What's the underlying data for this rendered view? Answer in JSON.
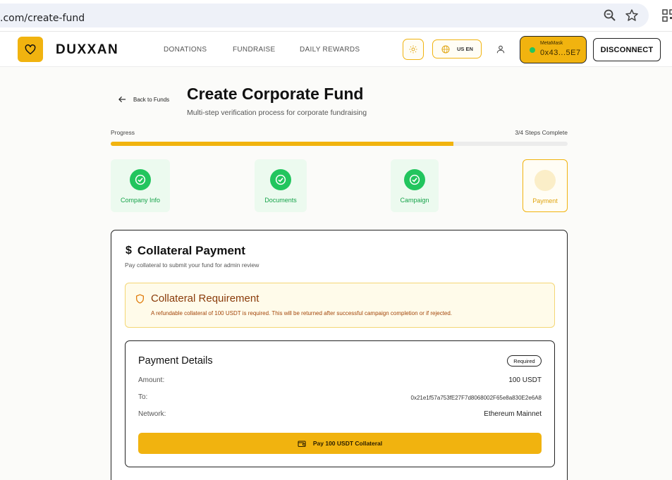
{
  "browser": {
    "url": ".com/create-fund"
  },
  "header": {
    "brand": "DUXXAN",
    "nav": [
      "DONATIONS",
      "FUNDRAISE",
      "DAILY REWARDS"
    ],
    "language": "US EN",
    "wallet": {
      "provider": "MetaMask",
      "address": "0x43...5E7"
    },
    "disconnect_label": "DISCONNECT"
  },
  "page": {
    "back_label": "Back to Funds",
    "title": "Create Corporate Fund",
    "subtitle": "Multi-step verification process for corporate fundraising"
  },
  "progress": {
    "label": "Progress",
    "status": "3/4 Steps Complete",
    "completed": 3,
    "total": 4,
    "fraction": 0.75
  },
  "steps": [
    {
      "label": "Company Info",
      "state": "complete"
    },
    {
      "label": "Documents",
      "state": "complete"
    },
    {
      "label": "Campaign",
      "state": "complete"
    },
    {
      "label": "Payment",
      "state": "current"
    }
  ],
  "collateral": {
    "title": "Collateral Payment",
    "subtitle": "Pay collateral to submit your fund for admin review",
    "requirement": {
      "title": "Collateral Requirement",
      "text": "A refundable collateral of 100 USDT is required. This will be returned after successful campaign completion or if rejected."
    },
    "details": {
      "title": "Payment Details",
      "badge": "Required",
      "amount_label": "Amount:",
      "amount_value": "100 USDT",
      "to_label": "To:",
      "to_value": "0x21e1f57a753fE27F7d8068002F65e8a830E2e6A8",
      "network_label": "Network:",
      "network_value": "Ethereum Mainnet",
      "pay_button": "Pay 100 USDT Collateral"
    }
  },
  "colors": {
    "accent": "#f1b30f",
    "success": "#22c55e",
    "warning_text": "#8a3b0a"
  }
}
